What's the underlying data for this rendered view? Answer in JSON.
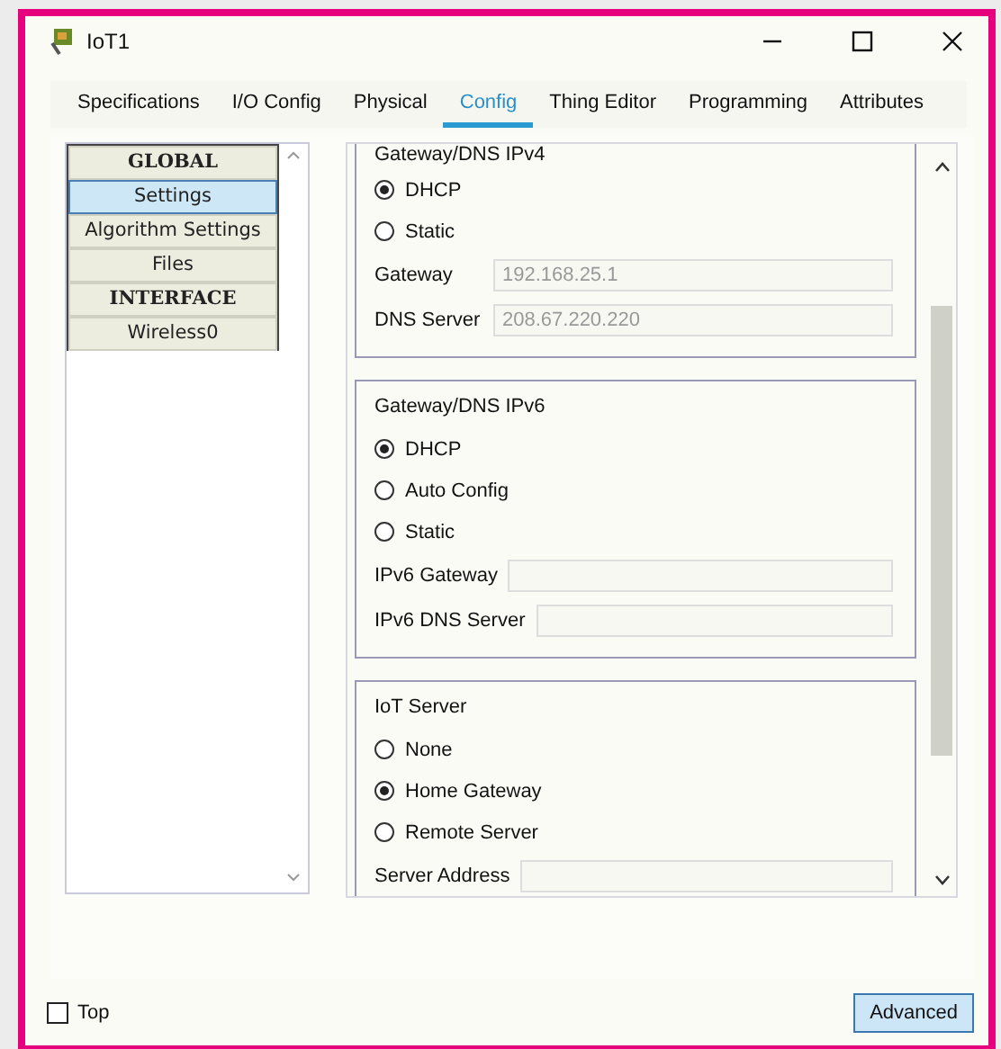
{
  "window": {
    "title": "IoT1"
  },
  "tabs": [
    {
      "label": "Specifications",
      "selected": false
    },
    {
      "label": "I/O Config",
      "selected": false
    },
    {
      "label": "Physical",
      "selected": false
    },
    {
      "label": "Config",
      "selected": true
    },
    {
      "label": "Thing Editor",
      "selected": false
    },
    {
      "label": "Programming",
      "selected": false
    },
    {
      "label": "Attributes",
      "selected": false
    }
  ],
  "sidebar": {
    "items": [
      {
        "kind": "header",
        "label": "GLOBAL",
        "selected": false
      },
      {
        "kind": "item",
        "label": "Settings",
        "selected": true
      },
      {
        "kind": "item",
        "label": "Algorithm Settings",
        "selected": false
      },
      {
        "kind": "item",
        "label": "Files",
        "selected": false
      },
      {
        "kind": "header",
        "label": "INTERFACE",
        "selected": false
      },
      {
        "kind": "item",
        "label": "Wireless0",
        "selected": false
      }
    ]
  },
  "sections": [
    {
      "title": "Gateway/DNS IPv4",
      "options": [
        {
          "label": "DHCP",
          "selected": true
        },
        {
          "label": "Static",
          "selected": false
        }
      ],
      "fields": [
        {
          "label": "Gateway",
          "value": "192.168.25.1"
        },
        {
          "label": "DNS Server",
          "value": "208.67.220.220"
        }
      ]
    },
    {
      "title": "Gateway/DNS IPv6",
      "options": [
        {
          "label": "DHCP",
          "selected": true
        },
        {
          "label": "Auto Config",
          "selected": false
        },
        {
          "label": "Static",
          "selected": false
        }
      ],
      "fields": [
        {
          "label": "IPv6 Gateway"
        },
        {
          "label": "IPv6 DNS Server"
        }
      ]
    },
    {
      "title": "IoT Server",
      "options": [
        {
          "label": "None",
          "selected": false
        },
        {
          "label": "Home Gateway",
          "selected": true
        },
        {
          "label": "Remote Server",
          "selected": false
        }
      ],
      "fields": [
        {
          "label": "Server Address"
        }
      ]
    }
  ],
  "footer": {
    "top_checkbox": {
      "label": "Top",
      "checked": false
    },
    "button": "Advanced"
  }
}
